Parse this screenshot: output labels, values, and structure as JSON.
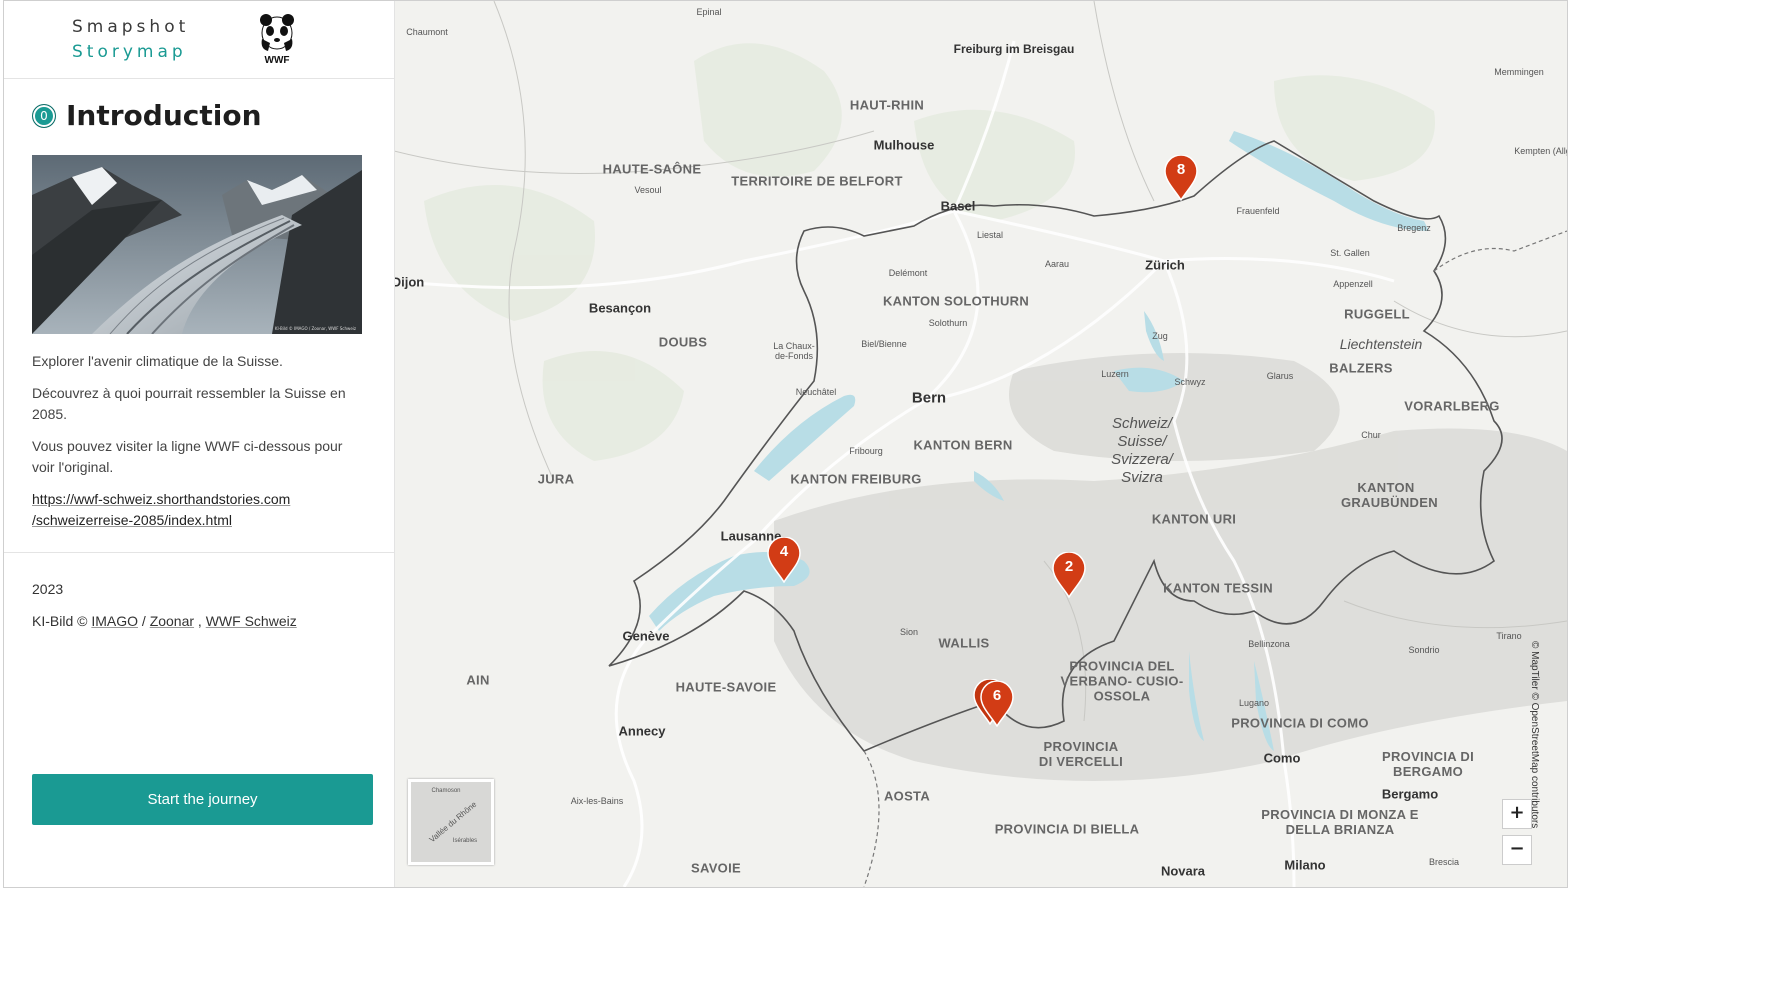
{
  "brand": {
    "line1": "Smapshot",
    "line2": "Storymap",
    "logo_text": "WWF"
  },
  "intro": {
    "number": "0",
    "title": "Introduction",
    "hero_credit": "KI-Bild © IMAGO / Zoonar, WWF Schweiz",
    "p1": "Explorer l'avenir climatique de la Suisse.",
    "p2": "Découvrez à quoi pourrait ressembler la Suisse en 2085.",
    "p3": "Vous pouvez visiter la ligne WWF ci-dessous pour voir l'original.",
    "link_line1": "https://wwf-schweiz.shorthandstories.com",
    "link_line2": "/schweizerreise-2085/index.html"
  },
  "meta": {
    "year": "2023",
    "credit_prefix": "KI-Bild © ",
    "credit_imago": "IMAGO",
    "credit_sep": " / ",
    "credit_zoonar": "Zoonar",
    "credit_comma": " , ",
    "credit_wwf": "WWF Schweiz"
  },
  "button": {
    "start": "Start the journey"
  },
  "map": {
    "labels": {
      "epinal": "Epinal",
      "chaumont": "Chaumont",
      "freiburg": "Freiburg im Breisgau",
      "haut_rhin": "HAUT-RHIN",
      "mulhouse": "Mulhouse",
      "haute_saone": "HAUTE-SAÔNE",
      "vesoul": "Vesoul",
      "territoire": "TERRITOIRE DE BELFORT",
      "basel": "Basel",
      "liestal": "Liestal",
      "zurich": "Zürich",
      "frauenfeld": "Frauenfeld",
      "memmingen": "Memmingen",
      "kempten": "Kempten (Allgäu)",
      "bregenz": "Bregenz",
      "st_gallen": "St. Gallen",
      "appenzell": "Appenzell",
      "rugell": "RUGGELL",
      "liechtenstein": "Liechtenstein",
      "balzers": "BALZERS",
      "vorarlberg": "VORARLBERG",
      "dijon": "Dijon",
      "besancon": "Besançon",
      "doubs": "DOUBS",
      "delemont": "Delémont",
      "solothurn_k": "KANTON SOLOTHURN",
      "solothurn": "Solothurn",
      "aarau": "Aarau",
      "zug": "Zug",
      "la_chaux": "La Chaux-de-Fonds",
      "biel": "Biel/Bienne",
      "luzern": "Luzern",
      "schwyz": "Schwyz",
      "glarus": "Glarus",
      "neuchatel": "Neuchâtel",
      "bern": "Bern",
      "kanton_bern": "KANTON BERN",
      "chur": "Chur",
      "switzerland": "Schweiz/ Suisse/ Svizzera/ Svizra",
      "jura": "JURA",
      "fribourg": "Fribourg",
      "kanton_freiburg": "KANTON FREIBURG",
      "graubunden": "KANTON GRAUBÜNDEN",
      "kanton_uri": "KANTON URI",
      "lausanne": "Lausanne",
      "kanton_tessin": "KANTON TESSIN",
      "geneve": "Genève",
      "sion": "Sion",
      "wallis": "WALLIS",
      "bellinzona": "Bellinzona",
      "tirano": "Tirano",
      "sondrio": "Sondrio",
      "ain": "AIN",
      "haute_savoie": "HAUTE-SAVOIE",
      "verbano": "PROVINCIA DEL VERBANO- CUSIO-OSSOLA",
      "lugano": "Lugano",
      "annecy": "Annecy",
      "como_prov": "PROVINCIA DI COMO",
      "vercelli": "PROVINCIA DI VERCELLI",
      "como": "Como",
      "bergamo_prov": "PROVINCIA DI BERGAMO",
      "aosta": "AOSTA",
      "bergamo": "Bergamo",
      "aix": "Aix-les-Bains",
      "monza": "PROVINCIA DI MONZA E DELLA BRIANZA",
      "biella": "PROVINCIA DI BIELLA",
      "savoie": "SAVOIE",
      "novara": "Novara",
      "milano": "Milano",
      "brescia": "Brescia",
      "chamoson": "Chamoson",
      "vallee": "Vallée du Rhône",
      "isérables": "Isérables"
    },
    "markers": [
      "8",
      "4",
      "2",
      "6"
    ],
    "zoom_in": "+",
    "zoom_out": "−",
    "attribution": "© MapTiler © OpenStreetMap contributors",
    "lake_color": "#b8dde6",
    "border_color": "#555555",
    "marker_color": "#d23c15"
  }
}
